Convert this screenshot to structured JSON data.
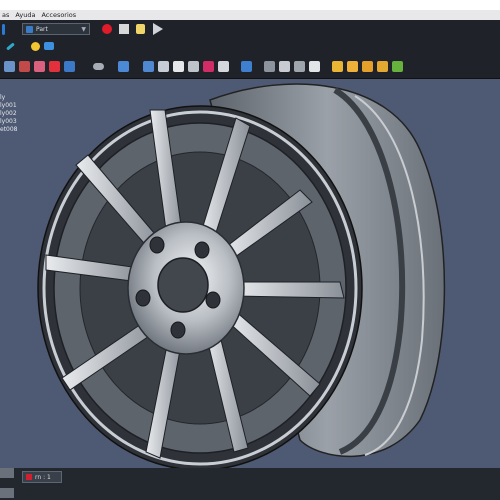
{
  "menu": {
    "items": [
      "as",
      "Ayuda",
      "Accesorios"
    ]
  },
  "toolbar": {
    "workbench_label": "Part",
    "macro_buttons": [
      "record-macro",
      "stop-macro",
      "edit-macro",
      "play-macro"
    ]
  },
  "tree": {
    "items": [
      "ly",
      "ly001",
      "ly002",
      "ly003",
      "et008"
    ]
  },
  "document_tab": {
    "label": "rn : 1"
  },
  "colors": {
    "background": "#4e5a73",
    "toolbar": "#1f2329",
    "record": "#e01b2a",
    "wheel_rim": "#9aa0a8",
    "wheel_face": "#7d838b"
  }
}
